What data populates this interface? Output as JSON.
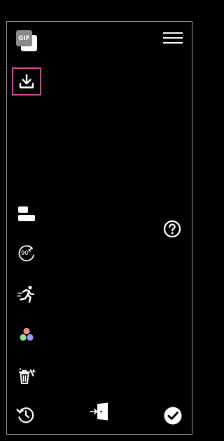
{
  "app": {
    "logo_text": "GIF"
  },
  "toolbar": {
    "rotate_label": "90°"
  },
  "icons": {
    "logo": "gif-logo",
    "menu": "hamburger-menu-icon",
    "download": "download-icon",
    "layout": "layout-icon",
    "help": "help-circle-icon",
    "rotate": "rotate-90-icon",
    "speed": "running-person-icon",
    "colors": "color-dots-icon",
    "clean": "trash-sparkle-icon",
    "history": "history-clock-icon",
    "exit": "exit-door-icon",
    "confirm": "check-circle-icon"
  },
  "colors": {
    "background": "#000000",
    "foreground": "#ffffff",
    "frame_border": "#9a9a9a",
    "selection_highlight": "#e8409a",
    "dot_red": "#f08c8c",
    "dot_green": "#8ee08e",
    "dot_blue": "#9a9af0"
  }
}
